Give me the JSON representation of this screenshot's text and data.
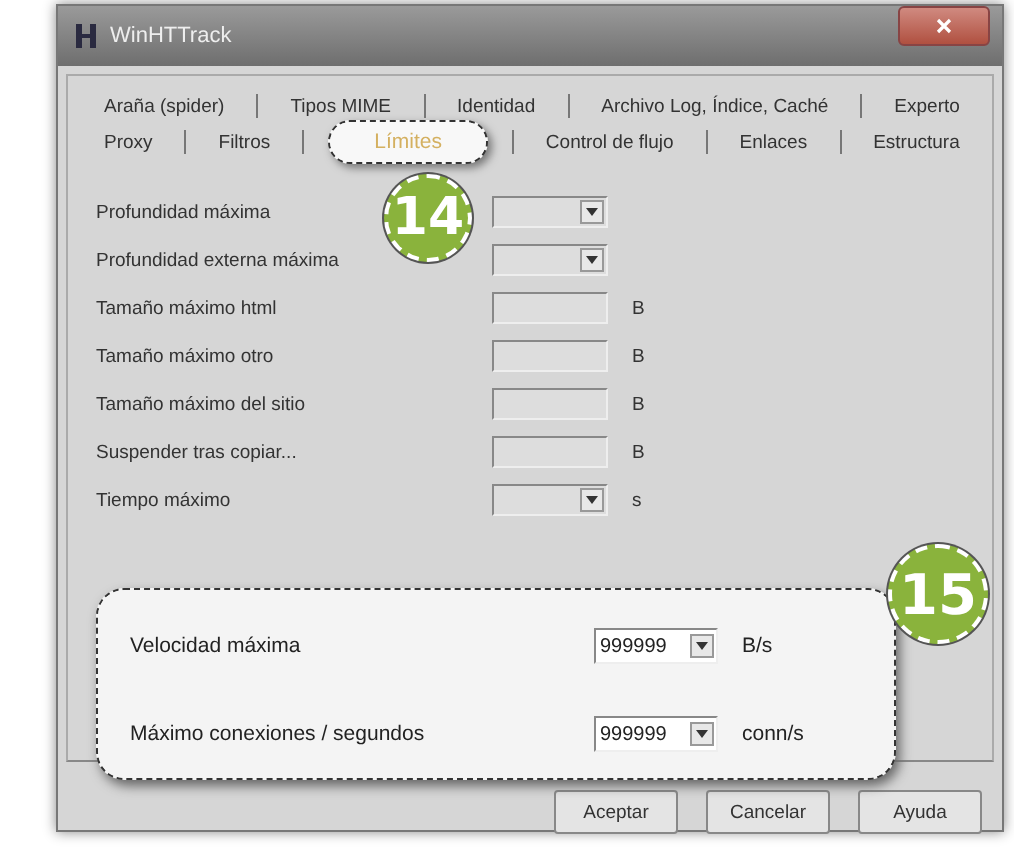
{
  "window": {
    "title": "WinHTTrack"
  },
  "tab_rows": [
    [
      {
        "label": "Araña (spider)",
        "selected": false
      },
      {
        "label": "Tipos MIME",
        "selected": false
      },
      {
        "label": "Identidad",
        "selected": false
      },
      {
        "label": "Archivo Log, Índice, Caché",
        "selected": false
      },
      {
        "label": "Experto",
        "selected": false
      }
    ],
    [
      {
        "label": "Proxy",
        "selected": false
      },
      {
        "label": "Filtros",
        "selected": false
      },
      {
        "label": "Límites",
        "selected": true
      },
      {
        "label": "Control de flujo",
        "selected": false
      },
      {
        "label": "Enlaces",
        "selected": false
      },
      {
        "label": "Estructura",
        "selected": false
      }
    ]
  ],
  "tab_badge": "14",
  "fields": [
    {
      "label": "Profundidad máxima",
      "kind": "dropdown"
    },
    {
      "label": "Profundidad externa máxima",
      "kind": "dropdown"
    },
    {
      "label": "Tamaño máximo html",
      "kind": "text",
      "unit": "B"
    },
    {
      "label": "Tamaño máximo otro",
      "kind": "text",
      "unit": "B"
    },
    {
      "label": "Tamaño máximo del sitio",
      "kind": "text",
      "unit": "B"
    },
    {
      "label": "Suspender tras copiar...",
      "kind": "text",
      "unit": "B"
    },
    {
      "label": "Tiempo máximo",
      "kind": "dropdown",
      "unit": "s"
    }
  ],
  "highlight": {
    "badge": "15",
    "fields": [
      {
        "label": "Velocidad máxima",
        "kind": "dropdown",
        "value": "999999",
        "unit": "B/s"
      },
      {
        "label": "Máximo conexiones / segundos",
        "kind": "dropdown",
        "value": "999999",
        "unit": "conn/s"
      }
    ]
  },
  "buttons": [
    "Aceptar",
    "Cancelar",
    "Ayuda"
  ]
}
